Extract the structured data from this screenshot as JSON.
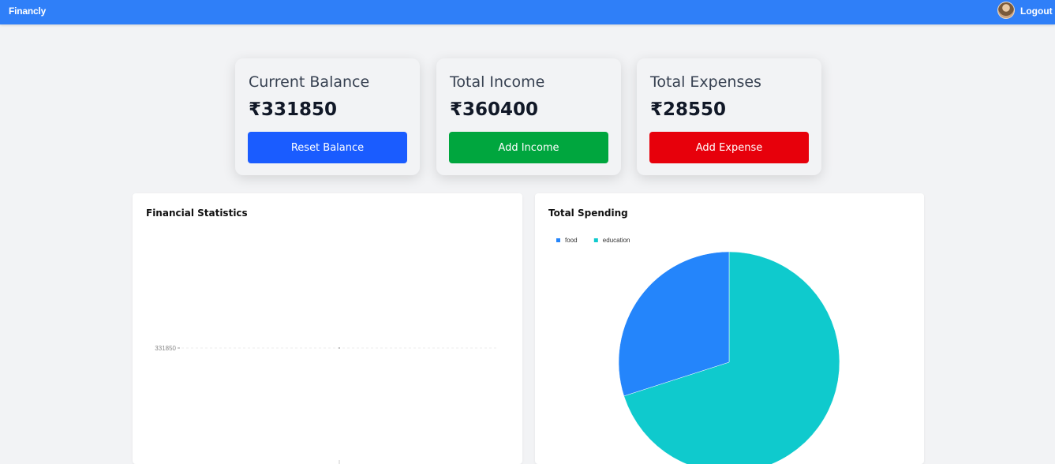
{
  "navbar": {
    "brand": "Financly",
    "logout_label": "Logout",
    "avatar_icon": "user-avatar-icon"
  },
  "cards": [
    {
      "title": "Current Balance",
      "value": "₹331850",
      "button_label": "Reset Balance",
      "button_color": "#1a5cff"
    },
    {
      "title": "Total Income",
      "value": "₹360400",
      "button_label": "Add Income",
      "button_color": "#00a63e"
    },
    {
      "title": "Total Expenses",
      "value": "₹28550",
      "button_label": "Add Expense",
      "button_color": "#e7000b"
    }
  ],
  "colors": {
    "navbar": "#2f7ff8",
    "page_background": "#f2f3f5"
  },
  "panels": {
    "statistics_title": "Financial Statistics",
    "spending_title": "Total Spending"
  },
  "chart_data": [
    {
      "type": "line",
      "title": "Financial Statistics",
      "y_ticks": [
        "331850"
      ],
      "series": [
        {
          "values": [
            331850
          ]
        }
      ],
      "grid": true
    },
    {
      "type": "pie",
      "title": "Total Spending",
      "legend_position": "top-left",
      "slices": [
        {
          "name": "food",
          "value": 8550,
          "color": "#2485fb"
        },
        {
          "name": "education",
          "value": 20000,
          "color": "#0fcacd"
        }
      ]
    }
  ]
}
